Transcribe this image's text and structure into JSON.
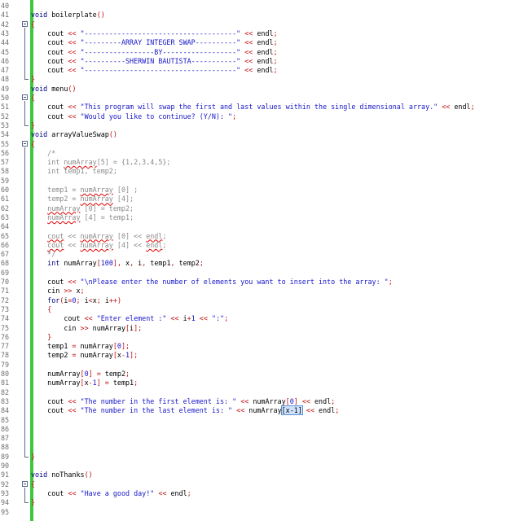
{
  "editor": {
    "lines": [
      {
        "n": "40",
        "c": ""
      },
      {
        "n": "41",
        "c": "void boilerplate()"
      },
      {
        "n": "42",
        "c": "{"
      },
      {
        "n": "43",
        "c": "    cout << \"-------------------------------------\" << endl;"
      },
      {
        "n": "44",
        "c": "    cout << \"---------ARRAY INTEGER SWAP----------\" << endl;"
      },
      {
        "n": "45",
        "c": "    cout << \"-----------------BY------------------\" << endl;"
      },
      {
        "n": "46",
        "c": "    cout << \"----------SHERWIN BAUTISTA-----------\" << endl;"
      },
      {
        "n": "47",
        "c": "    cout << \"-------------------------------------\" << endl;"
      },
      {
        "n": "48",
        "c": "}"
      },
      {
        "n": "49",
        "c": "void menu()"
      },
      {
        "n": "50",
        "c": "{"
      },
      {
        "n": "51",
        "c": "    cout << \"This program will swap the first and last values within the single dimensional array.\" << endl;"
      },
      {
        "n": "52",
        "c": "    cout << \"Would you like to continue? (Y/N): \";"
      },
      {
        "n": "53",
        "c": "}"
      },
      {
        "n": "54",
        "c": "void arrayValueSwap()"
      },
      {
        "n": "55",
        "c": "{"
      },
      {
        "n": "56",
        "c": "    /*"
      },
      {
        "n": "57",
        "c": "    int numArray[5] = {1,2,3,4,5};"
      },
      {
        "n": "58",
        "c": "    int temp1, temp2;"
      },
      {
        "n": "59",
        "c": ""
      },
      {
        "n": "60",
        "c": "    temp1 = numArray [0] ;"
      },
      {
        "n": "61",
        "c": "    temp2 = numArray [4];"
      },
      {
        "n": "62",
        "c": "    numArray [0] = temp2;"
      },
      {
        "n": "63",
        "c": "    numArray [4] = temp1;"
      },
      {
        "n": "64",
        "c": ""
      },
      {
        "n": "65",
        "c": "    cout << numArray [0] << endl;"
      },
      {
        "n": "66",
        "c": "    cout << numArray [4] << endl;"
      },
      {
        "n": "67",
        "c": "    */"
      },
      {
        "n": "68",
        "c": "    int numArray[100], x, i, temp1, temp2;"
      },
      {
        "n": "69",
        "c": ""
      },
      {
        "n": "70",
        "c": "    cout << \"\\nPlease enter the number of elements you want to insert into the array: \";"
      },
      {
        "n": "71",
        "c": "    cin >> x;"
      },
      {
        "n": "72",
        "c": "    for(i=0; i<x; i++)"
      },
      {
        "n": "73",
        "c": "    {"
      },
      {
        "n": "74",
        "c": "        cout << \"Enter element :\" << i+1 << \":\";"
      },
      {
        "n": "75",
        "c": "        cin >> numArray[i];"
      },
      {
        "n": "76",
        "c": "    }"
      },
      {
        "n": "77",
        "c": "    temp1 = numArray[0];"
      },
      {
        "n": "78",
        "c": "    temp2 = numArray[x-1];"
      },
      {
        "n": "79",
        "c": ""
      },
      {
        "n": "80",
        "c": "    numArray[0] = temp2;"
      },
      {
        "n": "81",
        "c": "    numArray[x-1] = temp1;"
      },
      {
        "n": "82",
        "c": ""
      },
      {
        "n": "83",
        "c": "    cout << \"The number in the first element is: \" << numArray[0] << endl;"
      },
      {
        "n": "84",
        "c": "    cout << \"The number in the last element is: \" << numArray[x-1] << endl;"
      },
      {
        "n": "85",
        "c": ""
      },
      {
        "n": "86",
        "c": ""
      },
      {
        "n": "87",
        "c": ""
      },
      {
        "n": "88",
        "c": ""
      },
      {
        "n": "89",
        "c": "}"
      },
      {
        "n": "90",
        "c": ""
      },
      {
        "n": "91",
        "c": "void noThanks()"
      },
      {
        "n": "92",
        "c": "{"
      },
      {
        "n": "93",
        "c": "    cout << \"Have a good day!\" << endl;"
      },
      {
        "n": "94",
        "c": "}"
      },
      {
        "n": "95",
        "c": ""
      }
    ]
  },
  "colors": {
    "keyword": "#000080",
    "string": "#1616c8",
    "operator": "#c01010",
    "comment": "#8a8a8a",
    "change_bar": "#3cc83c"
  }
}
